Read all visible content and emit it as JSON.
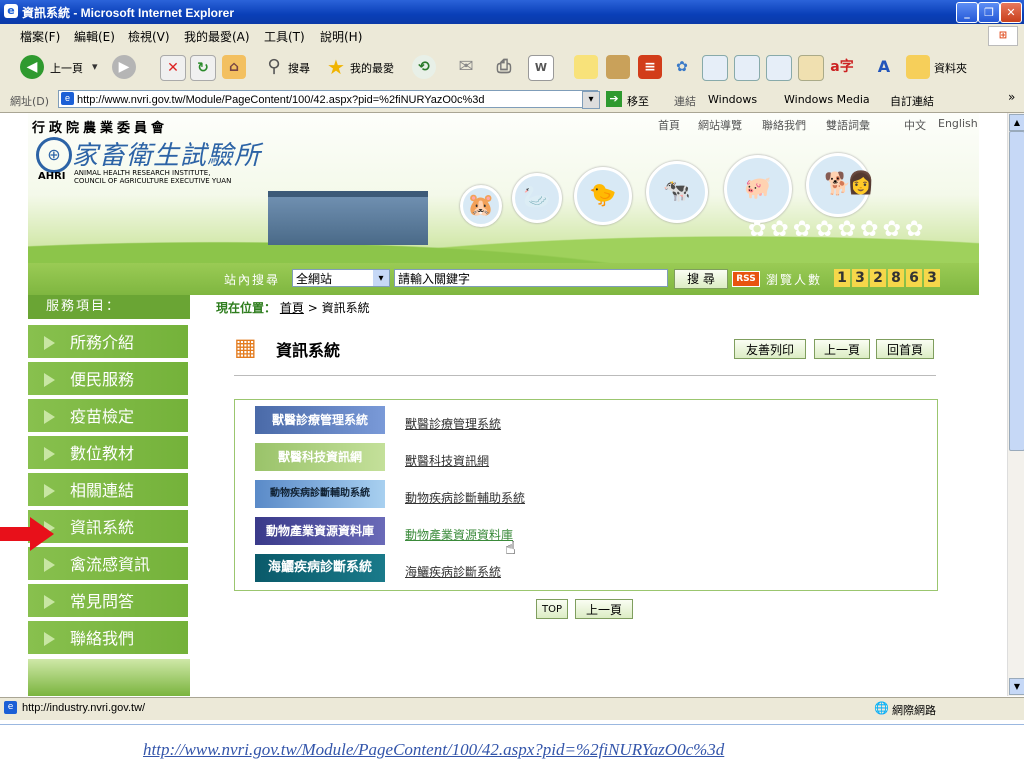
{
  "window": {
    "title": "資訊系統 - Microsoft Internet Explorer"
  },
  "menu": [
    "檔案(F)",
    "編輯(E)",
    "檢視(V)",
    "我的最愛(A)",
    "工具(T)",
    "說明(H)"
  ],
  "toolbar": {
    "back": "上一頁",
    "search": "搜尋",
    "favorites": "我的最愛",
    "folders": "資料夾"
  },
  "address": {
    "label": "網址(D)",
    "url": "http://www.nvri.gov.tw/Module/PageContent/100/42.aspx?pid=%2fiNURYazO0c%3d",
    "go": "移至",
    "links_label": "連結",
    "links": [
      "Windows",
      "Windows Media",
      "自訂連結"
    ]
  },
  "site": {
    "ministry": "行政院農業委員會",
    "name": "家畜衛生試驗所",
    "abbr": "AHRI",
    "en_name_1": "ANIMAL HEALTH RESEARCH INSTITUTE,",
    "en_name_2": "COUNCIL OF AGRICULTURE EXECUTIVE YUAN",
    "top_links": [
      "首頁",
      "網站導覽",
      "聯絡我們",
      "雙語詞彙",
      "中文",
      "English"
    ],
    "search_label": "站內搜尋",
    "search_scope": "全網站",
    "search_placeholder": "請輸入關鍵字",
    "search_button": "搜 尋",
    "rss": "RSS",
    "visitor_label": "瀏覽人數",
    "visitor_count": [
      "1",
      "3",
      "2",
      "8",
      "6",
      "3"
    ]
  },
  "sidebar": {
    "heading": "服務項目：",
    "items": [
      "所務介紹",
      "便民服務",
      "疫苗檢定",
      "數位教材",
      "相關連結",
      "資訊系統",
      "禽流感資訊",
      "常見問答",
      "聯絡我們"
    ],
    "active_index": 5
  },
  "main": {
    "breadcrumb_label": "現在位置：",
    "breadcrumb_home": "首頁",
    "breadcrumb_sep": ">",
    "breadcrumb_current": "資訊系統",
    "title": "資訊系統",
    "buttons": [
      "友善列印",
      "上一頁",
      "回首頁"
    ],
    "systems": [
      {
        "banner": "獸醫診療管理系統",
        "link": "獸醫診療管理系統"
      },
      {
        "banner": "獸醫科技資訊網",
        "link": "獸醫科技資訊網"
      },
      {
        "banner": "動物疾病診斷輔助系統",
        "link": "動物疾病診斷輔助系統"
      },
      {
        "banner": "動物產業資源資料庫",
        "link": "動物產業資源資料庫"
      },
      {
        "banner": "海鱺疾病診斷系統",
        "link": "海鱺疾病診斷系統"
      }
    ],
    "top_button": "TOP",
    "back_button": "上一頁"
  },
  "status": {
    "url": "http://industry.nvri.gov.tw/",
    "zone": "網際網路"
  },
  "caption": "http://www.nvri.gov.tw/Module/PageContent/100/42.aspx?pid=%2fiNURYazO0c%3d",
  "colors": {
    "accent_green": "#74b23a",
    "link_hover": "#3a8a3a",
    "arrow_red": "#e8101a"
  }
}
